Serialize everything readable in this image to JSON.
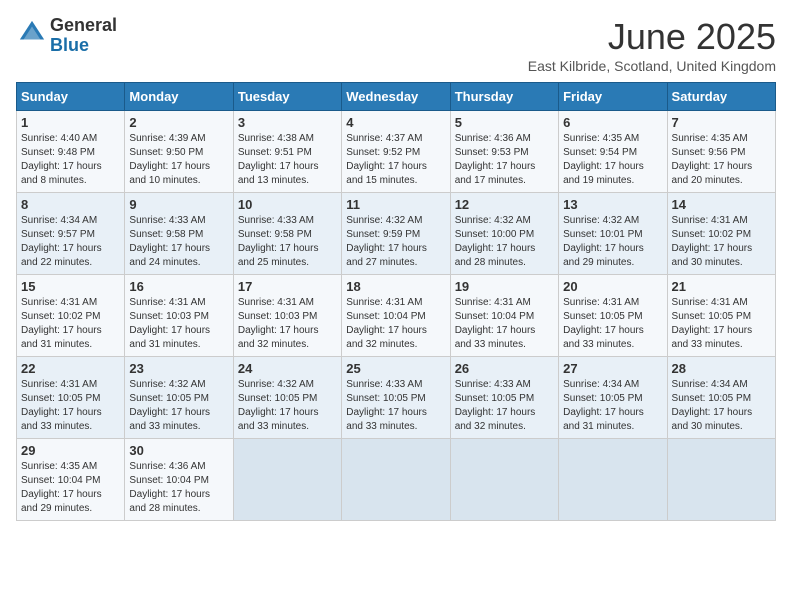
{
  "logo": {
    "general": "General",
    "blue": "Blue"
  },
  "title": "June 2025",
  "location": "East Kilbride, Scotland, United Kingdom",
  "days_header": [
    "Sunday",
    "Monday",
    "Tuesday",
    "Wednesday",
    "Thursday",
    "Friday",
    "Saturday"
  ],
  "weeks": [
    [
      {
        "day": "1",
        "sunrise": "4:40 AM",
        "sunset": "9:48 PM",
        "daylight": "17 hours and 8 minutes."
      },
      {
        "day": "2",
        "sunrise": "4:39 AM",
        "sunset": "9:50 PM",
        "daylight": "17 hours and 10 minutes."
      },
      {
        "day": "3",
        "sunrise": "4:38 AM",
        "sunset": "9:51 PM",
        "daylight": "17 hours and 13 minutes."
      },
      {
        "day": "4",
        "sunrise": "4:37 AM",
        "sunset": "9:52 PM",
        "daylight": "17 hours and 15 minutes."
      },
      {
        "day": "5",
        "sunrise": "4:36 AM",
        "sunset": "9:53 PM",
        "daylight": "17 hours and 17 minutes."
      },
      {
        "day": "6",
        "sunrise": "4:35 AM",
        "sunset": "9:54 PM",
        "daylight": "17 hours and 19 minutes."
      },
      {
        "day": "7",
        "sunrise": "4:35 AM",
        "sunset": "9:56 PM",
        "daylight": "17 hours and 20 minutes."
      }
    ],
    [
      {
        "day": "8",
        "sunrise": "4:34 AM",
        "sunset": "9:57 PM",
        "daylight": "17 hours and 22 minutes."
      },
      {
        "day": "9",
        "sunrise": "4:33 AM",
        "sunset": "9:58 PM",
        "daylight": "17 hours and 24 minutes."
      },
      {
        "day": "10",
        "sunrise": "4:33 AM",
        "sunset": "9:58 PM",
        "daylight": "17 hours and 25 minutes."
      },
      {
        "day": "11",
        "sunrise": "4:32 AM",
        "sunset": "9:59 PM",
        "daylight": "17 hours and 27 minutes."
      },
      {
        "day": "12",
        "sunrise": "4:32 AM",
        "sunset": "10:00 PM",
        "daylight": "17 hours and 28 minutes."
      },
      {
        "day": "13",
        "sunrise": "4:32 AM",
        "sunset": "10:01 PM",
        "daylight": "17 hours and 29 minutes."
      },
      {
        "day": "14",
        "sunrise": "4:31 AM",
        "sunset": "10:02 PM",
        "daylight": "17 hours and 30 minutes."
      }
    ],
    [
      {
        "day": "15",
        "sunrise": "4:31 AM",
        "sunset": "10:02 PM",
        "daylight": "17 hours and 31 minutes."
      },
      {
        "day": "16",
        "sunrise": "4:31 AM",
        "sunset": "10:03 PM",
        "daylight": "17 hours and 31 minutes."
      },
      {
        "day": "17",
        "sunrise": "4:31 AM",
        "sunset": "10:03 PM",
        "daylight": "17 hours and 32 minutes."
      },
      {
        "day": "18",
        "sunrise": "4:31 AM",
        "sunset": "10:04 PM",
        "daylight": "17 hours and 32 minutes."
      },
      {
        "day": "19",
        "sunrise": "4:31 AM",
        "sunset": "10:04 PM",
        "daylight": "17 hours and 33 minutes."
      },
      {
        "day": "20",
        "sunrise": "4:31 AM",
        "sunset": "10:05 PM",
        "daylight": "17 hours and 33 minutes."
      },
      {
        "day": "21",
        "sunrise": "4:31 AM",
        "sunset": "10:05 PM",
        "daylight": "17 hours and 33 minutes."
      }
    ],
    [
      {
        "day": "22",
        "sunrise": "4:31 AM",
        "sunset": "10:05 PM",
        "daylight": "17 hours and 33 minutes."
      },
      {
        "day": "23",
        "sunrise": "4:32 AM",
        "sunset": "10:05 PM",
        "daylight": "17 hours and 33 minutes."
      },
      {
        "day": "24",
        "sunrise": "4:32 AM",
        "sunset": "10:05 PM",
        "daylight": "17 hours and 33 minutes."
      },
      {
        "day": "25",
        "sunrise": "4:33 AM",
        "sunset": "10:05 PM",
        "daylight": "17 hours and 33 minutes."
      },
      {
        "day": "26",
        "sunrise": "4:33 AM",
        "sunset": "10:05 PM",
        "daylight": "17 hours and 32 minutes."
      },
      {
        "day": "27",
        "sunrise": "4:34 AM",
        "sunset": "10:05 PM",
        "daylight": "17 hours and 31 minutes."
      },
      {
        "day": "28",
        "sunrise": "4:34 AM",
        "sunset": "10:05 PM",
        "daylight": "17 hours and 30 minutes."
      }
    ],
    [
      {
        "day": "29",
        "sunrise": "4:35 AM",
        "sunset": "10:04 PM",
        "daylight": "17 hours and 29 minutes."
      },
      {
        "day": "30",
        "sunrise": "4:36 AM",
        "sunset": "10:04 PM",
        "daylight": "17 hours and 28 minutes."
      },
      null,
      null,
      null,
      null,
      null
    ]
  ]
}
